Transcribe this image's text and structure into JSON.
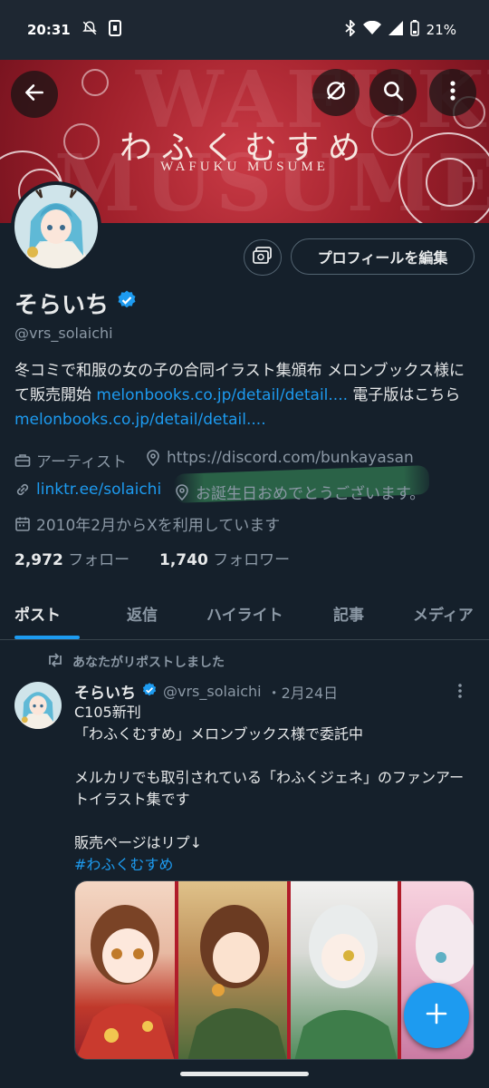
{
  "status_bar": {
    "time": "20:31",
    "battery": "21%"
  },
  "banner": {
    "logo_jp": "わふくむすめ",
    "logo_en": "WAFUKU MUSUME",
    "bg_text_1": "WAFUKU",
    "bg_text_2": "MUSUME"
  },
  "header_icons": {
    "back": "arrow-left-icon",
    "grok": "slash-circle-icon",
    "search": "search-icon",
    "more": "more-vertical-icon"
  },
  "profile": {
    "edit_button": "プロフィールを編集",
    "name": "そらいち",
    "handle": "@vrs_solaichi",
    "bio_1": "冬コミで和服の女の子の合同イラスト集頒布 メロンブックス様にて販売開始 ",
    "bio_link_1": "melonbooks.co.jp/detail/detail....",
    "bio_2": " 電子版はこちら ",
    "bio_link_2": "melonbooks.co.jp/detail/detail....",
    "category": "アーティスト",
    "website": "https://discord.com/bunkayasan",
    "link": "linktr.ee/solaichi",
    "location": "お誕生日おめでとうございます。",
    "joined": "2010年2月からXを利用しています",
    "following_count": "2,972",
    "following_label": "フォロー",
    "followers_count": "1,740",
    "followers_label": "フォロワー"
  },
  "tabs": [
    "ポスト",
    "返信",
    "ハイライト",
    "記事",
    "メディア"
  ],
  "post": {
    "repost_label": "あなたがリポストしました",
    "author": "そらいち",
    "handle": "@vrs_solaichi",
    "date": "・2月24日",
    "text": "C105新刊\n「わふくむすめ」メロンブックス様で委託中\n\nメルカリでも取引されている「わふくジェネ」のファンアートイラスト集です\n\n販売ページはリプ↓",
    "hashtag": "#わふくむすめ"
  },
  "colors": {
    "accent": "#1d9bf0",
    "background": "#15202b",
    "banner": "#a1212c",
    "muted": "#8b98a5"
  }
}
